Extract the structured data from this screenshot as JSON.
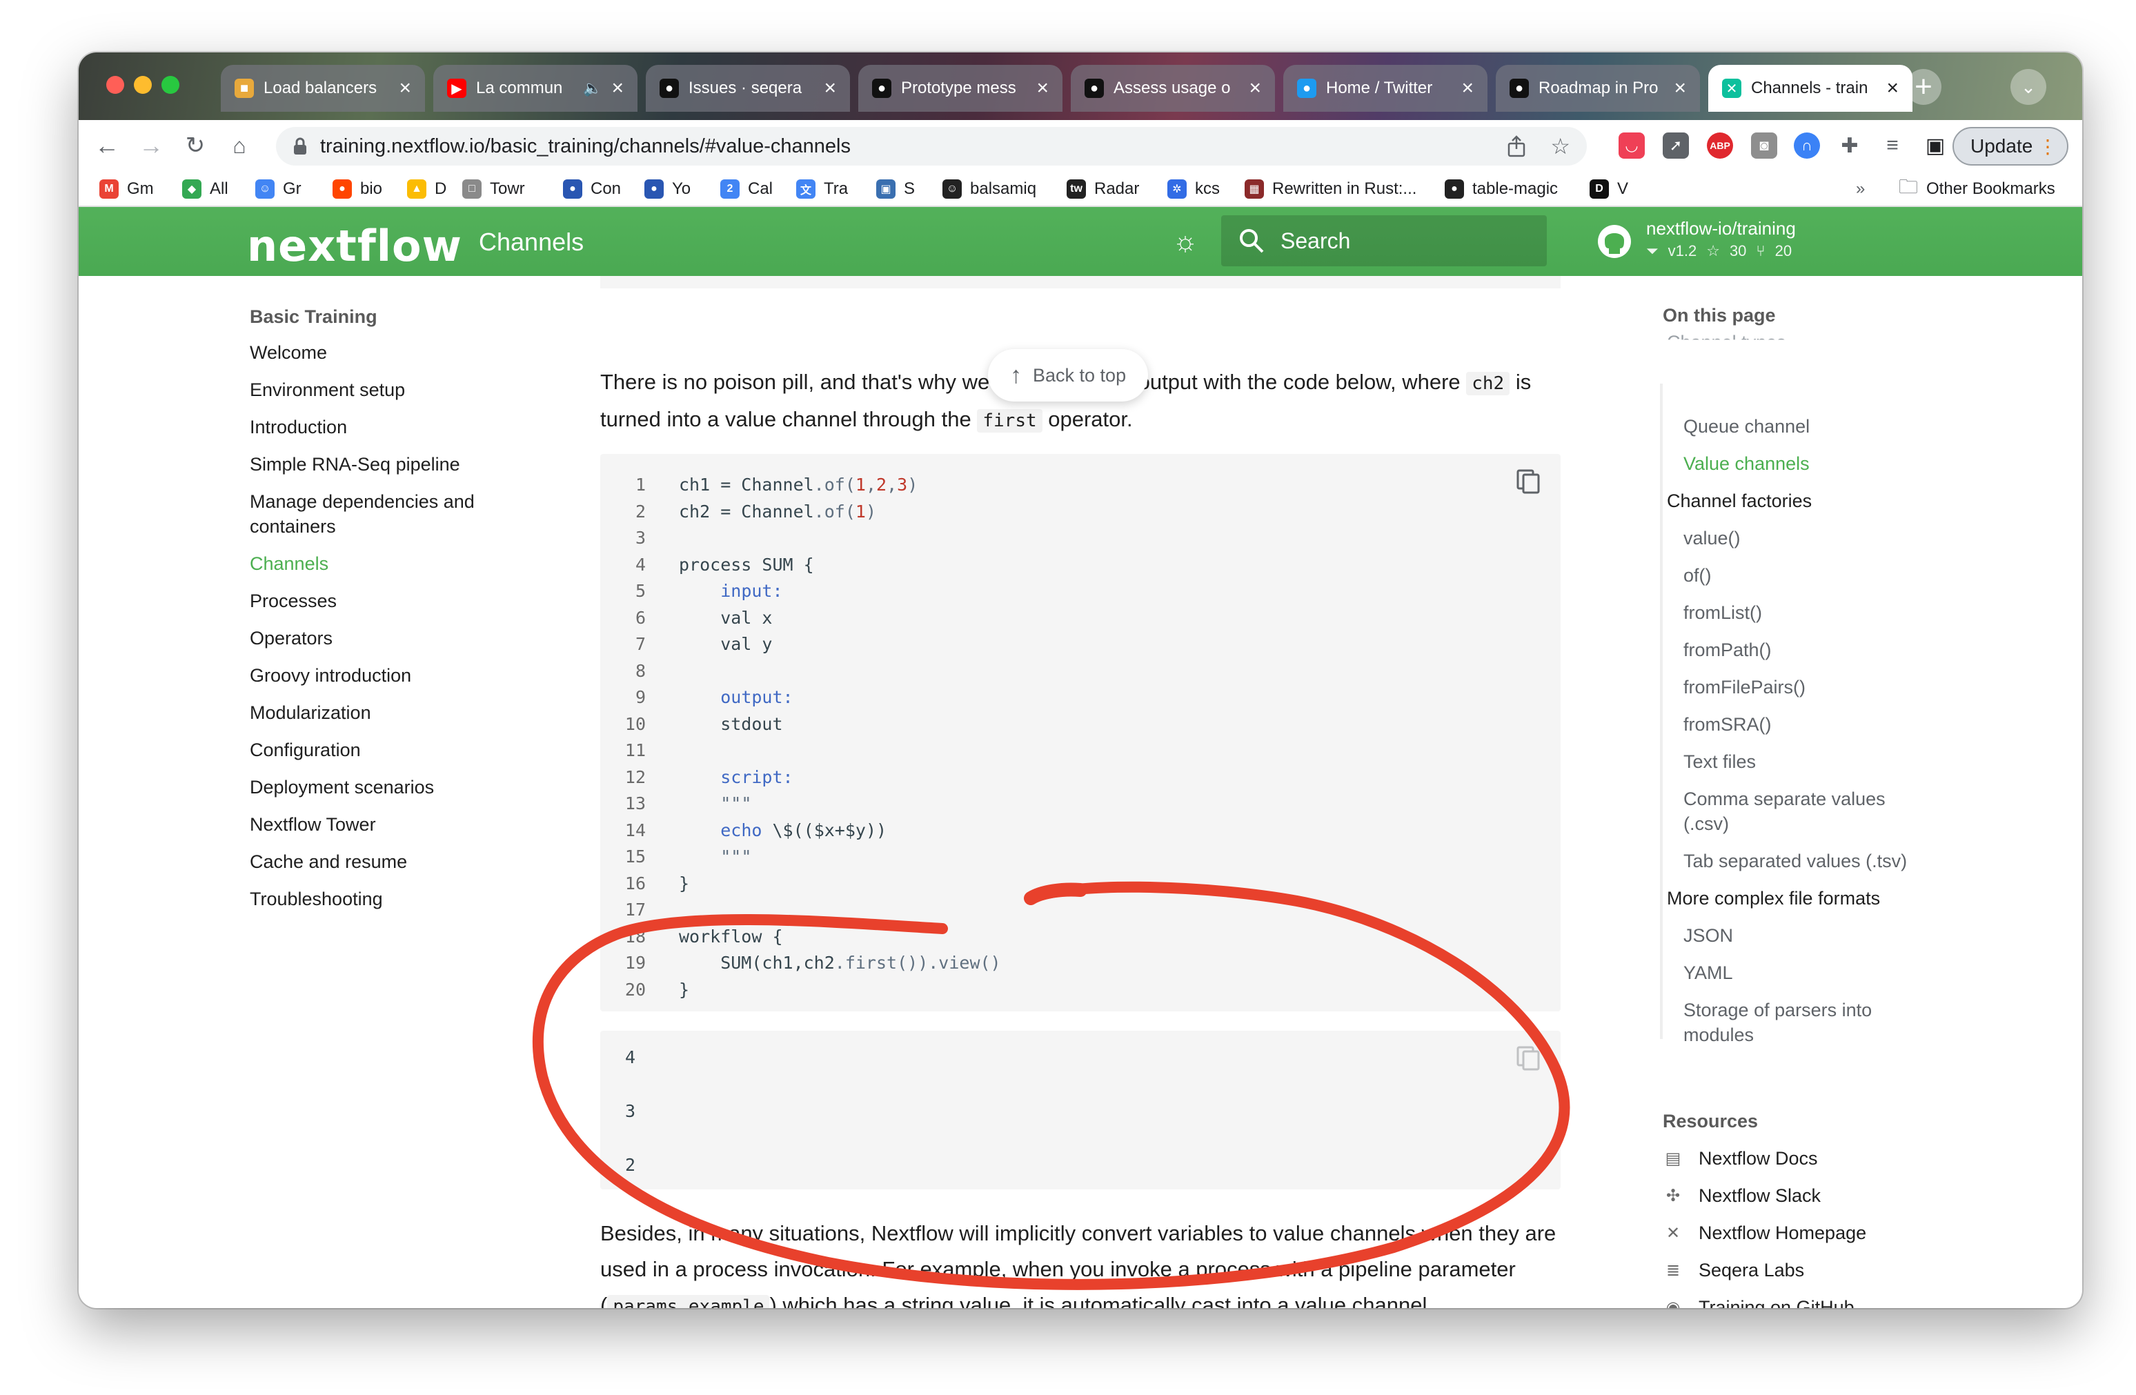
{
  "browser": {
    "tabs": [
      {
        "title": "Load balancers",
        "favicon": "box-icon",
        "color": "#e8a93c"
      },
      {
        "title": "La commun",
        "favicon": "youtube-icon",
        "color": "#ff0000",
        "audio": "🔈"
      },
      {
        "title": "Issues · seqera",
        "favicon": "github-icon",
        "color": "#111111"
      },
      {
        "title": "Prototype mess",
        "favicon": "github-icon",
        "color": "#111111"
      },
      {
        "title": "Assess usage o",
        "favicon": "github-icon",
        "color": "#111111"
      },
      {
        "title": "Home / Twitter",
        "favicon": "twitter-icon",
        "color": "#1d9bf0"
      },
      {
        "title": "Roadmap in Pro",
        "favicon": "github-icon",
        "color": "#111111"
      },
      {
        "title": "Channels - train",
        "favicon": "nextflow-icon",
        "color": "#0dc09d"
      }
    ],
    "url": "training.nextflow.io/basic_training/channels/#value-channels",
    "update_label": "Update",
    "bookmarks": [
      {
        "label": "Gm",
        "color": "#ea4335",
        "glyph": "M"
      },
      {
        "label": "All",
        "color": "#34a853",
        "glyph": "◆"
      },
      {
        "label": "Gr",
        "color": "#4285f4",
        "glyph": "☺"
      },
      {
        "label": "bio",
        "color": "#ff4500",
        "glyph": "●"
      },
      {
        "label": "D",
        "color": "#fbbc04",
        "glyph": "▲"
      },
      {
        "label": "Towr",
        "color": "#8a8a8a",
        "glyph": "□"
      },
      {
        "label": "Con",
        "color": "#2956b2",
        "glyph": "●"
      },
      {
        "label": "Yo",
        "color": "#2956b2",
        "glyph": "●"
      },
      {
        "label": "Cal",
        "color": "#4285f4",
        "glyph": "2"
      },
      {
        "label": "Tra",
        "color": "#4285f4",
        "glyph": "文"
      },
      {
        "label": "S",
        "color": "#3a6fb0",
        "glyph": "▣"
      },
      {
        "label": "balsamiq",
        "color": "#222222",
        "glyph": "☺"
      },
      {
        "label": "Radar",
        "color": "#222222",
        "glyph": "tw"
      },
      {
        "label": "kcs",
        "color": "#326ce5",
        "glyph": "✲"
      },
      {
        "label": "Rewritten in Rust:...",
        "color": "#8b2a2a",
        "glyph": "▦"
      },
      {
        "label": "table-magic",
        "color": "#222222",
        "glyph": "●"
      },
      {
        "label": "V",
        "color": "#101010",
        "glyph": "D"
      }
    ],
    "bookmarks_overflow": "»",
    "other_bookmarks": "Other Bookmarks"
  },
  "site": {
    "logo": "nextflow",
    "title": "Channels",
    "search_placeholder": "Search",
    "repo_name": "nextflow-io/training",
    "repo_version": "v1.2",
    "repo_stars": "30",
    "repo_forks": "20"
  },
  "left_nav": {
    "heading": "Basic Training",
    "items": [
      {
        "label": "Welcome",
        "active": false
      },
      {
        "label": "Environment setup",
        "active": false
      },
      {
        "label": "Introduction",
        "active": false
      },
      {
        "label": "Simple RNA-Seq pipeline",
        "active": false
      },
      {
        "label": "Manage dependencies and\ncontainers",
        "active": false
      },
      {
        "label": "Channels",
        "active": true
      },
      {
        "label": "Processes",
        "active": false
      },
      {
        "label": "Operators",
        "active": false
      },
      {
        "label": "Groovy introduction",
        "active": false
      },
      {
        "label": "Modularization",
        "active": false
      },
      {
        "label": "Configuration",
        "active": false
      },
      {
        "label": "Deployment scenarios",
        "active": false
      },
      {
        "label": "Nextflow Tower",
        "active": false
      },
      {
        "label": "Cache and resume",
        "active": false
      },
      {
        "label": "Troubleshooting",
        "active": false
      }
    ]
  },
  "content": {
    "back_to_top": "Back to top",
    "intro_parts": [
      "There is no poison pill, and that's why we get the correct output with the code below, where ",
      "ch2",
      " is turned into a value channel through the ",
      "first",
      " operator."
    ],
    "code_lines": [
      {
        "n": "1",
        "tokens": [
          [
            "",
            "ch1 = Channel"
          ],
          [
            "fn",
            ".of("
          ],
          [
            "num",
            "1"
          ],
          [
            "fn",
            ","
          ],
          [
            "num",
            "2"
          ],
          [
            "fn",
            ","
          ],
          [
            "num",
            "3"
          ],
          [
            "fn",
            ")"
          ]
        ]
      },
      {
        "n": "2",
        "tokens": [
          [
            "",
            "ch2 = Channel"
          ],
          [
            "fn",
            ".of("
          ],
          [
            "num",
            "1"
          ],
          [
            "fn",
            ")"
          ]
        ]
      },
      {
        "n": "3",
        "tokens": []
      },
      {
        "n": "4",
        "tokens": [
          [
            "",
            "process SUM {"
          ]
        ]
      },
      {
        "n": "5",
        "tokens": [
          [
            "",
            "    "
          ],
          [
            "kw",
            "input:"
          ]
        ]
      },
      {
        "n": "6",
        "tokens": [
          [
            "",
            "    val x"
          ]
        ]
      },
      {
        "n": "7",
        "tokens": [
          [
            "",
            "    val y"
          ]
        ]
      },
      {
        "n": "8",
        "tokens": []
      },
      {
        "n": "9",
        "tokens": [
          [
            "",
            "    "
          ],
          [
            "kw",
            "output:"
          ]
        ]
      },
      {
        "n": "10",
        "tokens": [
          [
            "",
            "    stdout"
          ]
        ]
      },
      {
        "n": "11",
        "tokens": []
      },
      {
        "n": "12",
        "tokens": [
          [
            "",
            "    "
          ],
          [
            "kw",
            "script:"
          ]
        ]
      },
      {
        "n": "13",
        "tokens": [
          [
            "",
            "    "
          ],
          [
            "fn",
            "\"\"\""
          ]
        ]
      },
      {
        "n": "14",
        "tokens": [
          [
            "",
            "    "
          ],
          [
            "kw",
            "echo"
          ],
          [
            "",
            " \\$(($x+$y))"
          ]
        ]
      },
      {
        "n": "15",
        "tokens": [
          [
            "",
            "    "
          ],
          [
            "fn",
            "\"\"\""
          ]
        ]
      },
      {
        "n": "16",
        "tokens": [
          [
            "",
            "}"
          ]
        ]
      },
      {
        "n": "17",
        "tokens": []
      },
      {
        "n": "18",
        "tokens": [
          [
            "",
            "workflow {"
          ]
        ]
      },
      {
        "n": "19",
        "tokens": [
          [
            "",
            "    SUM(ch1,ch2"
          ],
          [
            "fn",
            ".first())"
          ],
          [
            "fn",
            ".view()"
          ]
        ]
      },
      {
        "n": "20",
        "tokens": [
          [
            "",
            "}"
          ]
        ]
      }
    ],
    "output_lines": [
      "4",
      "3",
      "2"
    ],
    "para2_parts": [
      "Besides, in many situations, Nextflow will implicitly convert variables to value channels when they are used in a process invocation. For example, when you invoke a process with a pipeline parameter (",
      "params.example",
      ") which has a string value, it is automatically cast into a value channel."
    ]
  },
  "toc": {
    "heading": "On this page",
    "items": [
      {
        "label": "Channel types",
        "level": 0,
        "partial": true
      },
      {
        "label": "Queue channel",
        "level": 1
      },
      {
        "label": "Value channels",
        "level": 1,
        "active": true
      },
      {
        "label": "Channel factories",
        "level": 0
      },
      {
        "label": "value()",
        "level": 1
      },
      {
        "label": "of()",
        "level": 1
      },
      {
        "label": "fromList()",
        "level": 1
      },
      {
        "label": "fromPath()",
        "level": 1
      },
      {
        "label": "fromFilePairs()",
        "level": 1
      },
      {
        "label": "fromSRA()",
        "level": 1
      },
      {
        "label": "Text files",
        "level": 1
      },
      {
        "label": "Comma separate values\n(.csv)",
        "level": 1
      },
      {
        "label": "Tab separated values (.tsv)",
        "level": 1
      },
      {
        "label": "More complex file formats",
        "level": 0
      },
      {
        "label": "JSON",
        "level": 1
      },
      {
        "label": "YAML",
        "level": 1
      },
      {
        "label": "Storage of parsers into\nmodules",
        "level": 1
      }
    ],
    "resources_heading": "Resources",
    "resources": [
      {
        "label": "Nextflow Docs",
        "icon": "book-icon",
        "glyph": "▤"
      },
      {
        "label": "Nextflow Slack",
        "icon": "slack-icon",
        "glyph": "✣"
      },
      {
        "label": "Nextflow Homepage",
        "icon": "nextflow-x-icon",
        "glyph": "✕"
      },
      {
        "label": "Seqera Labs",
        "icon": "seqera-icon",
        "glyph": "≣"
      },
      {
        "label": "Training on GitHub",
        "icon": "github-icon",
        "glyph": "◉"
      }
    ]
  },
  "colors": {
    "accent_green": "#4caf50",
    "annotation_red": "#e8412c"
  }
}
